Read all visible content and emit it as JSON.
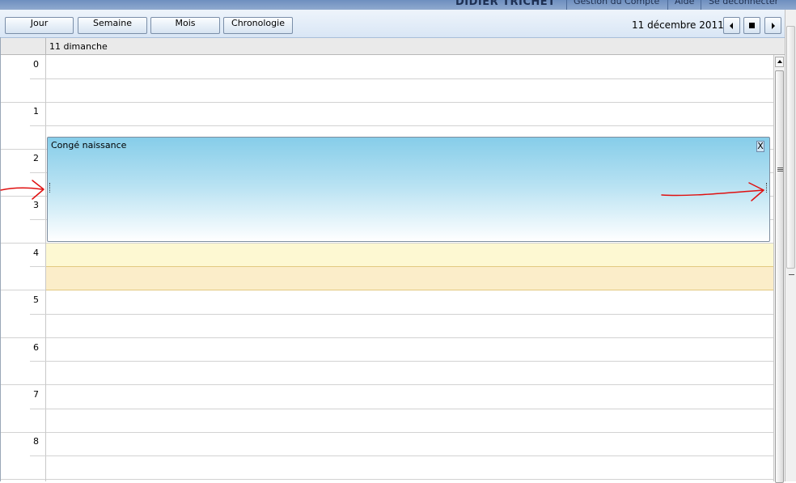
{
  "header": {
    "user_name": "DIDIER TRICHET",
    "links": [
      "Gestion du Compte",
      "Aide",
      "Se déconnecter"
    ]
  },
  "toolbar": {
    "views": [
      "Jour",
      "Semaine",
      "Mois",
      "Chronologie"
    ],
    "current_date": "11 décembre 2011"
  },
  "day": {
    "header": "11 dimanche"
  },
  "hours": [
    "0",
    "1",
    "2",
    "3",
    "4",
    "5",
    "6",
    "7",
    "8"
  ],
  "appointment": {
    "title": "Congé naissance",
    "close_label": "X",
    "background_top": "#86cde9",
    "background_bottom": "#ffffff"
  },
  "colors": {
    "busy_light": "#fdf8d2",
    "busy_dark": "#fbedc9",
    "annotation_arrow": "#e01010"
  }
}
